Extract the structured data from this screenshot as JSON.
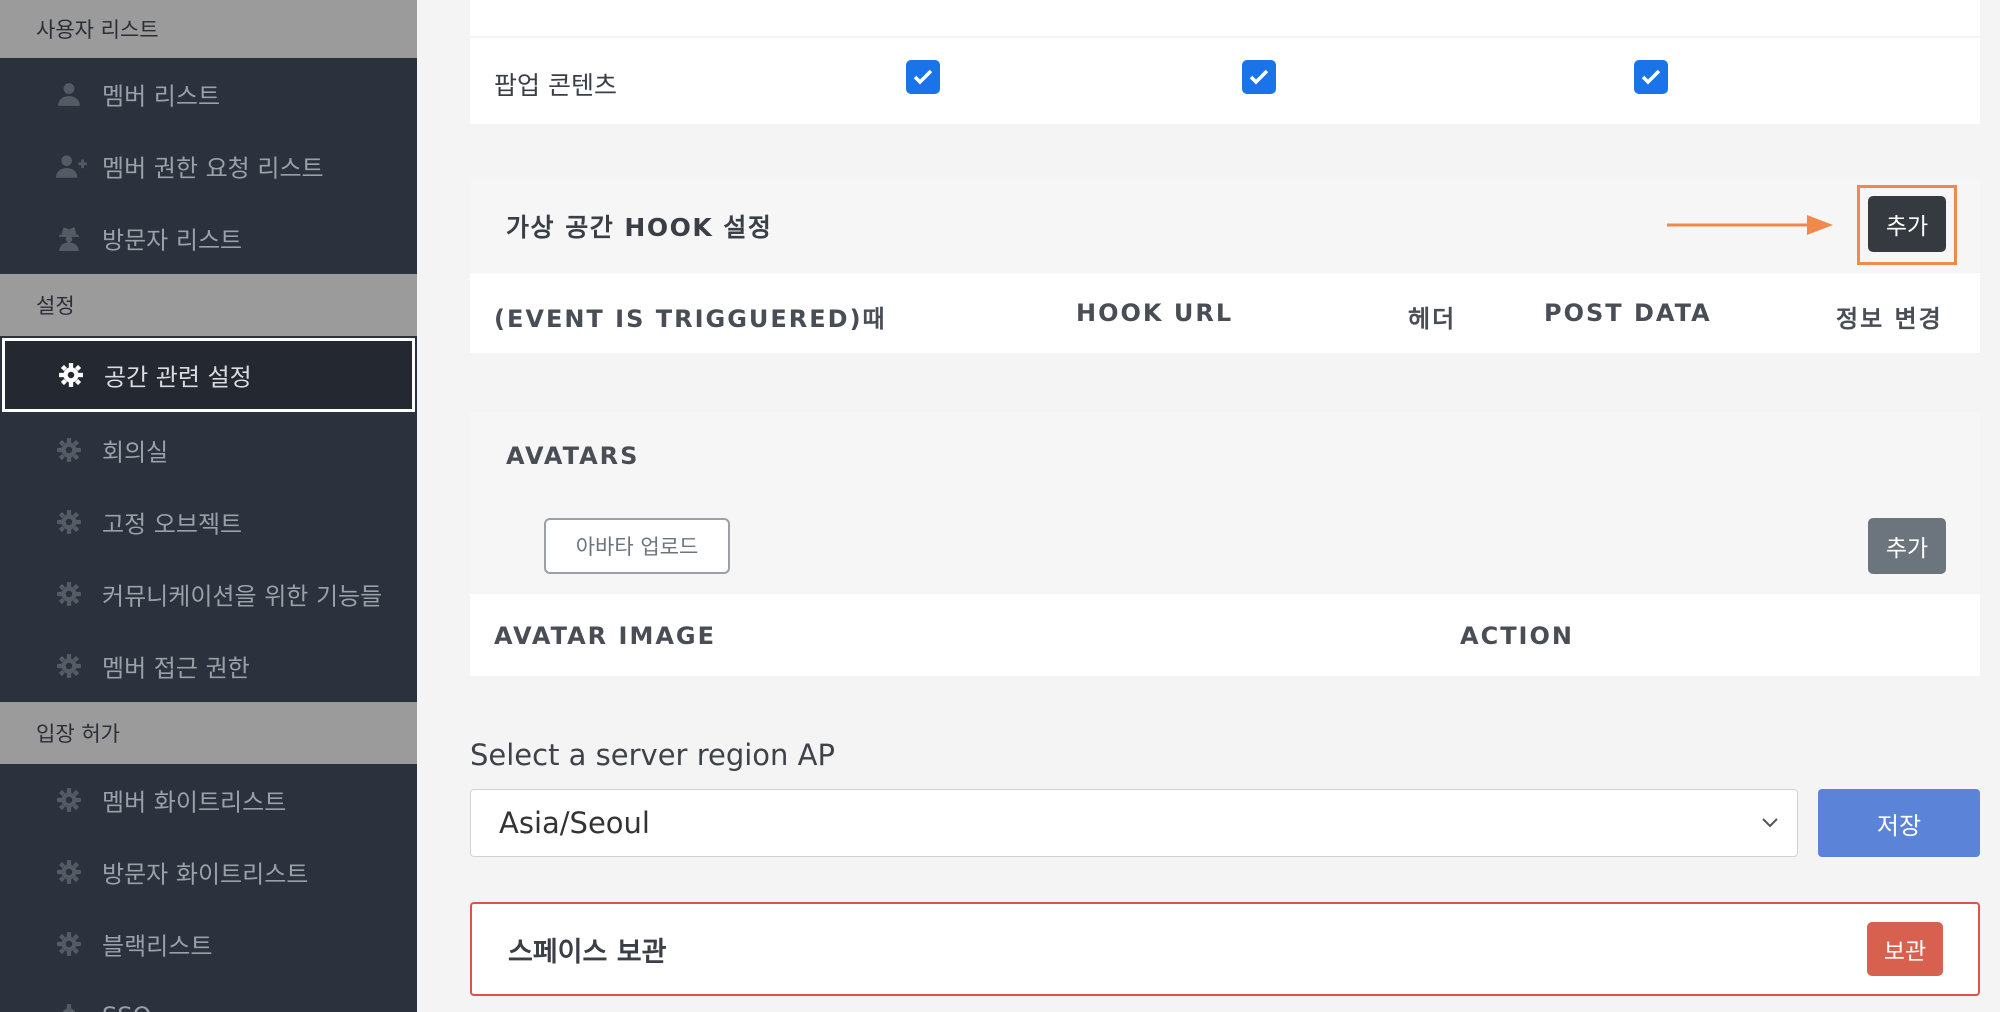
{
  "sidebar": {
    "section_user_list": "사용자 리스트",
    "member_list": "멤버 리스트",
    "member_permission_request_list": "멤버 권한 요청 리스트",
    "visitor_list": "방문자 리스트",
    "section_settings": "설정",
    "space_settings": "공간 관련 설정",
    "meeting_room": "회의실",
    "fixed_object": "고정 오브젝트",
    "communication_features": "커뮤니케이션을 위한 기능들",
    "member_access": "멤버 접근 권한",
    "section_entry_permission": "입장 허가",
    "member_whitelist": "멤버 화이트리스트",
    "visitor_whitelist": "방문자 화이트리스트",
    "blacklist": "블랙리스트",
    "sso": "SSO"
  },
  "popup_row": {
    "label": "팝업 콘텐츠"
  },
  "hook": {
    "title": "가상 공간 HOOK 설정",
    "add_label": "추가",
    "columns": [
      "(EVENT IS TRIGGUERED)때",
      "HOOK URL",
      "헤더",
      "POST DATA",
      "정보 변경"
    ]
  },
  "avatars": {
    "title": "AVATARS",
    "upload_label": "아바타 업로드",
    "add_label": "추가",
    "columns": [
      "AVATAR IMAGE",
      "ACTION"
    ]
  },
  "region": {
    "label": "Select a server region AP",
    "selected": "Asia/Seoul",
    "save_label": "저장"
  },
  "archive": {
    "title": "스페이스 보관",
    "button_label": "보관"
  },
  "colors": {
    "sidebar_bg": "#2c323d",
    "section_header_bg": "#9b9b9b",
    "checkbox_blue": "#1a73e8",
    "highlight_orange": "#f08a4b",
    "save_blue": "#5b84d8",
    "archive_red": "#d7604f"
  }
}
